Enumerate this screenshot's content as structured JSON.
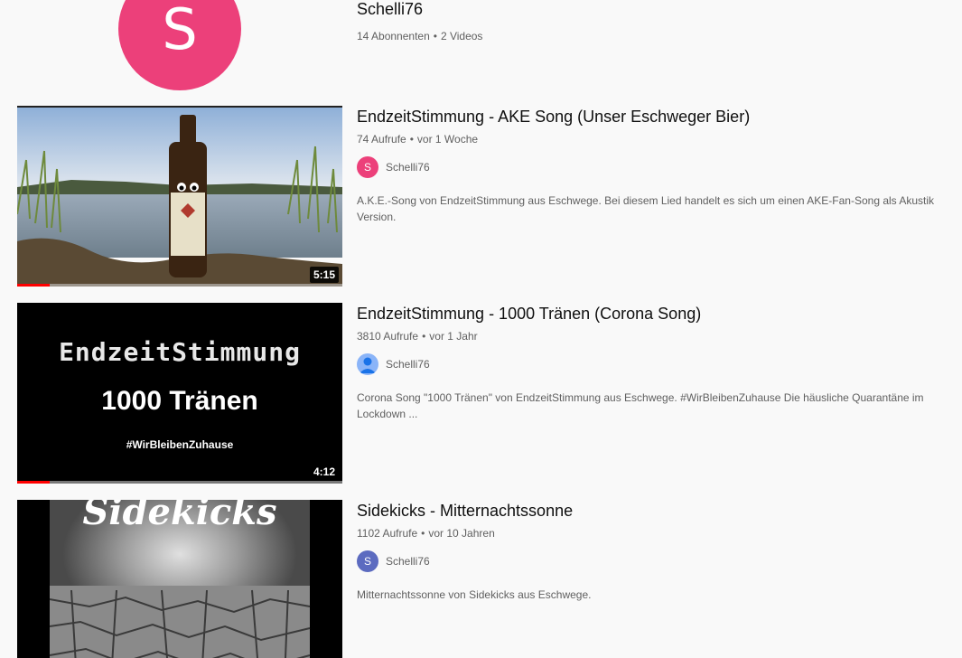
{
  "channel": {
    "avatar_letter": "S",
    "avatar_color": "#ec407a",
    "name": "Schelli76",
    "subscribers": "14 Abonnenten",
    "videos": "2 Videos"
  },
  "videos": [
    {
      "title": "EndzeitStimmung - AKE Song (Unser Eschweger Bier)",
      "views": "74 Aufrufe",
      "age": "vor 1 Woche",
      "owner": "Schelli76",
      "owner_avatar_letter": "S",
      "owner_avatar_color": "#ec407a",
      "description": "A.K.E.-Song von EndzeitStimmung aus Eschwege. Bei diesem Lied handelt es sich um einen AKE-Fan-Song als Akustik Version.",
      "duration": "5:15",
      "watched_fraction": 0.1
    },
    {
      "title": "EndzeitStimmung - 1000 Tränen (Corona Song)",
      "views": "3810 Aufrufe",
      "age": "vor 1 Jahr",
      "owner": "Schelli76",
      "owner_avatar_color": "#8ab4f8",
      "description": "Corona Song \"1000 Tränen\" von EndzeitStimmung aus Eschwege. #WirBleibenZuhause Die häusliche Quarantäne im Lockdown ...",
      "duration": "4:12",
      "watched_fraction": 0.1,
      "thumb_text_1": "EndzeitStimmung",
      "thumb_text_2": "1000 Tränen",
      "thumb_text_3": "#WirBleibenZuhause"
    },
    {
      "title": "Sidekicks - Mitternachtssonne",
      "views": "1102 Aufrufe",
      "age": "vor 10 Jahren",
      "owner": "Schelli76",
      "owner_avatar_letter": "S",
      "owner_avatar_color": "#5c6bc0",
      "description": "Mitternachtssonne von Sidekicks aus Eschwege.",
      "thumb_text_1": "Sidekicks"
    }
  ],
  "separator": "•"
}
